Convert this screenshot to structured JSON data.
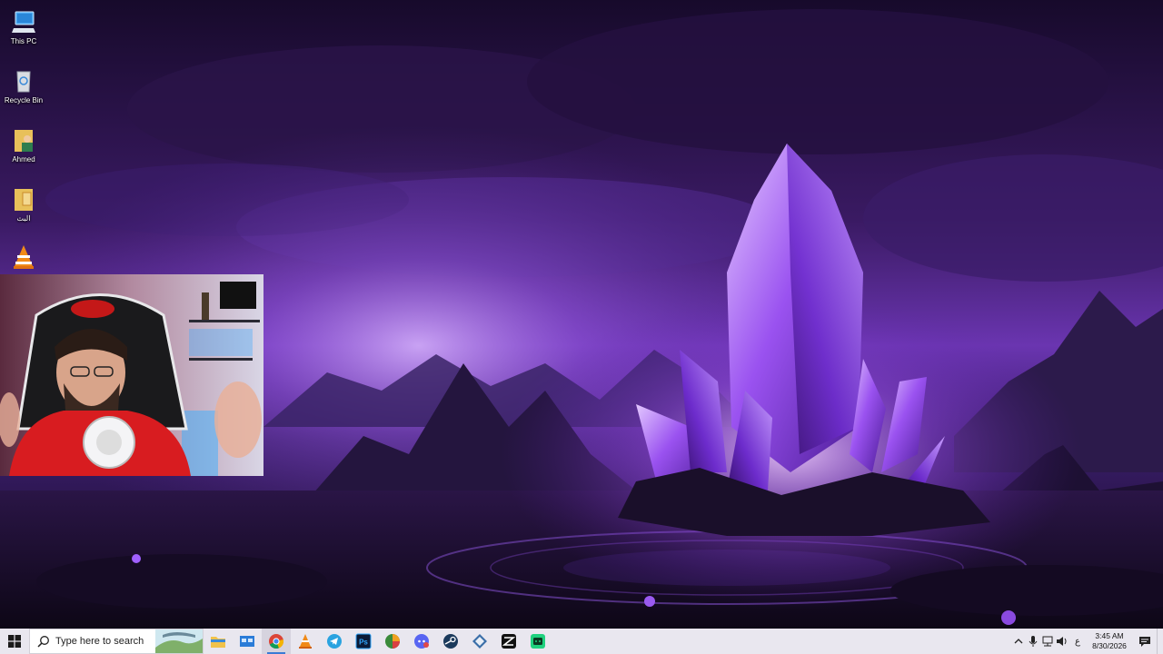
{
  "desktop": {
    "icons": [
      {
        "label": "This PC",
        "icon": "computer-icon"
      },
      {
        "label": "Recycle Bin",
        "icon": "recycle-bin-icon"
      },
      {
        "label": "Ahmed",
        "icon": "user-folder-icon"
      },
      {
        "label": "البث",
        "icon": "folder-icon"
      },
      {
        "label": "",
        "icon": "vlc-icon"
      }
    ]
  },
  "taskbar": {
    "search_placeholder": "Type here to search",
    "apps": [
      {
        "name": "file-explorer",
        "icon": "folder-icon"
      },
      {
        "name": "store",
        "icon": "window-icon"
      },
      {
        "name": "chrome",
        "icon": "chrome-icon",
        "active": true
      },
      {
        "name": "vlc",
        "icon": "vlc-icon"
      },
      {
        "name": "telegram",
        "icon": "telegram-icon"
      },
      {
        "name": "photoshop",
        "icon": "photoshop-icon",
        "text": "Ps"
      },
      {
        "name": "app-orb",
        "icon": "orb-icon"
      },
      {
        "name": "discord",
        "icon": "discord-icon"
      },
      {
        "name": "steam",
        "icon": "steam-icon"
      },
      {
        "name": "app-diamond",
        "icon": "diamond-icon"
      },
      {
        "name": "capcut",
        "icon": "capcut-icon"
      },
      {
        "name": "app-green",
        "icon": "green-app-icon"
      }
    ],
    "tray": {
      "language": "ع",
      "time": "3:45 AM",
      "date": "8/30/2026"
    }
  },
  "colors": {
    "taskbar_bg": "#e9e7ef",
    "accent": "#3a7bd5",
    "wallpaper_purple": "#7a3ad8"
  }
}
